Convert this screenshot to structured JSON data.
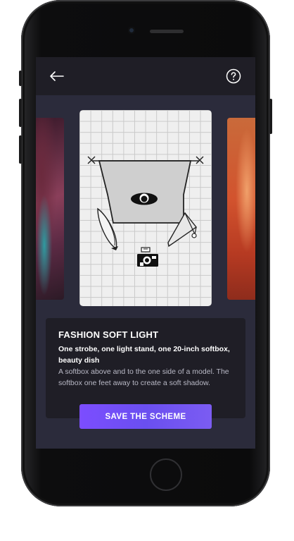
{
  "topbar": {
    "back_icon": "arrow-left-icon",
    "help_icon": "question-circle-icon"
  },
  "scheme": {
    "title": "FASHION SOFT LIGHT",
    "equipment": "One strobe, one light stand, one 20-inch softbox, beauty dish",
    "description": "A softbox above and to the one side of a model. The softbox one feet away to create a soft shadow."
  },
  "actions": {
    "save_label": "SAVE THE SCHEME"
  },
  "colors": {
    "accent": "#7c4dff",
    "screen_bg": "#2b2b3b",
    "card_bg": "#1f1e26"
  }
}
